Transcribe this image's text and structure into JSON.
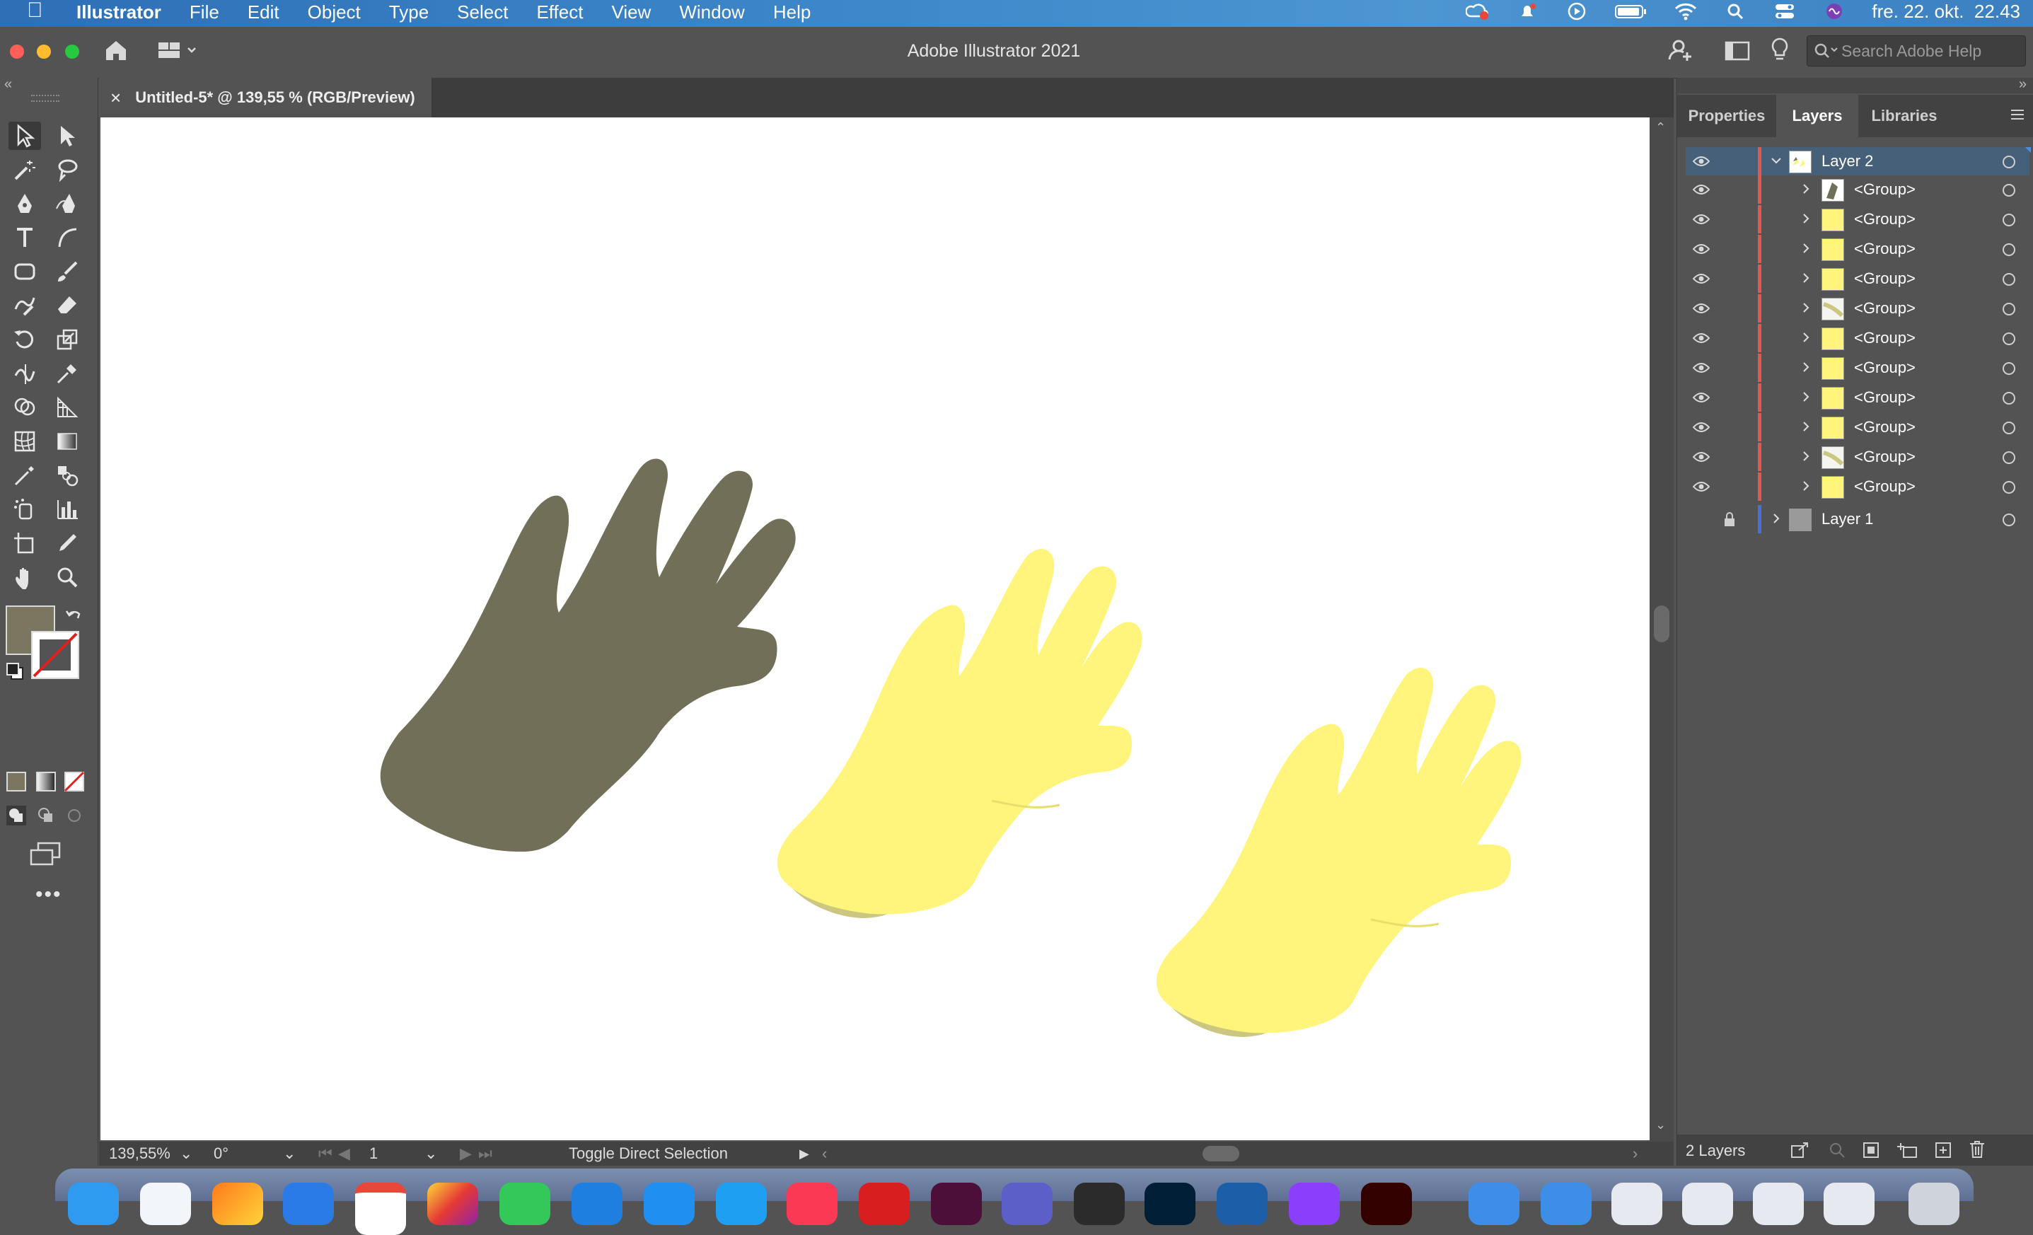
{
  "menubar": {
    "app_name": "Illustrator",
    "items": [
      "File",
      "Edit",
      "Object",
      "Type",
      "Select",
      "Effect",
      "View",
      "Window",
      "Help"
    ],
    "datetime": "fre. 22. okt.  22.43"
  },
  "titlebar": {
    "title": "Adobe Illustrator 2021",
    "search_placeholder": "Search Adobe Help"
  },
  "document": {
    "tab_title": "Untitled-5* @ 139,55 % (RGB/Preview)",
    "close_glyph": "×"
  },
  "statusbar": {
    "zoom": "139,55%",
    "rotation": "0°",
    "artboard_number": "1",
    "status_text": "Toggle Direct Selection"
  },
  "panel": {
    "tabs": [
      "Properties",
      "Layers",
      "Libraries"
    ],
    "active_tab": "Layers",
    "layer_count": "2 Layers"
  },
  "layers": {
    "layer2": {
      "name": "Layer 2",
      "color": "#e0584f"
    },
    "groups": [
      {
        "name": "<Group>",
        "thumb": "dark-hand"
      },
      {
        "name": "<Group>",
        "thumb": "yellow"
      },
      {
        "name": "<Group>",
        "thumb": "yellow"
      },
      {
        "name": "<Group>",
        "thumb": "yellow"
      },
      {
        "name": "<Group>",
        "thumb": "shadow"
      },
      {
        "name": "<Group>",
        "thumb": "yellow"
      },
      {
        "name": "<Group>",
        "thumb": "yellow"
      },
      {
        "name": "<Group>",
        "thumb": "yellow"
      },
      {
        "name": "<Group>",
        "thumb": "yellow"
      },
      {
        "name": "<Group>",
        "thumb": "shadow"
      },
      {
        "name": "<Group>",
        "thumb": "yellow"
      }
    ],
    "layer1": {
      "name": "Layer 1",
      "color": "#4a6fd8",
      "locked": true
    }
  },
  "colors": {
    "dark_hand": "#726f58",
    "yellow_hand": "#fff57c",
    "hand_shadow": "#cbc680",
    "fill_swatch": "#7a7660",
    "accent_blue": "#46607a"
  }
}
